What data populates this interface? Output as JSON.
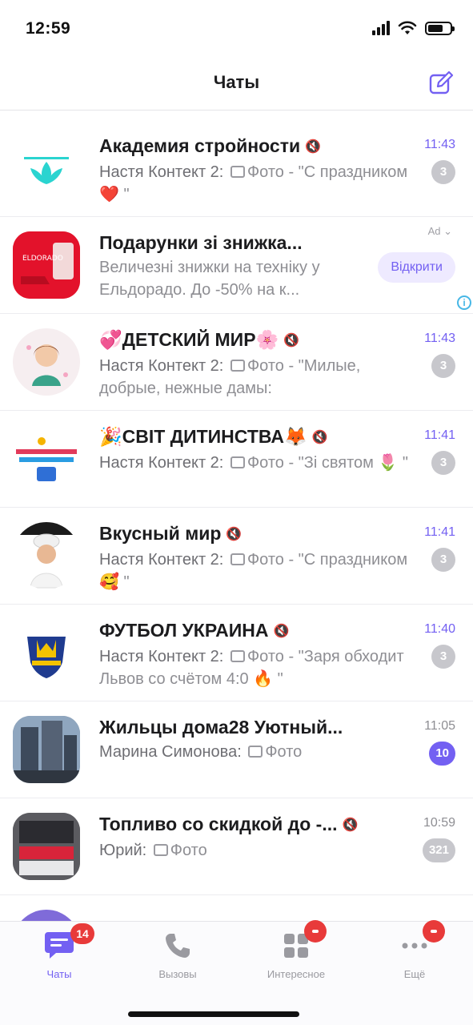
{
  "status_bar": {
    "time": "12:59"
  },
  "header": {
    "title": "Чаты"
  },
  "ad": {
    "label": "Ad",
    "title": "Подарунки зі знижка...",
    "text": "Величезні знижки на техніку у Ельдорадо. До -50% на к...",
    "button": "Відкрити"
  },
  "chats": [
    {
      "name": "Академия стройности",
      "sender": "Настя Контект 2:",
      "text": "Фото - \"С праздником ❤️ \"",
      "time": "11:43",
      "badge": "3"
    },
    {
      "name": "💞ДЕТСКИЙ МИР🌸",
      "sender": "Настя Контект 2:",
      "text": "Фото - \"Милые, добрые, нежные дамы:",
      "time": "11:43",
      "badge": "3"
    },
    {
      "name": "🎉СВІТ ДИТИНСТВА🦊",
      "sender": "Настя Контект 2:",
      "text": "Фото - \"Зі святом 🌷 \"",
      "time": "11:41",
      "badge": "3"
    },
    {
      "name": "Вкусный мир",
      "sender": "Настя Контект 2:",
      "text": "Фото - \"С праздником 🥰 \"",
      "time": "11:41",
      "badge": "3"
    },
    {
      "name": "ФУТБОЛ УКРАИНА",
      "sender": "Настя Контект 2:",
      "text": "Фото - \"Заря обходит Львов со счётом 4:0 🔥 \"",
      "time": "11:40",
      "badge": "3"
    },
    {
      "name": "Жильцы дома28 Уютный...",
      "sender": "Марина Симонова:",
      "text": "Фото",
      "time": "11:05",
      "badge": "10"
    },
    {
      "name": "Топливо со скидкой до -...",
      "sender": "Юрий:",
      "text": "Фото",
      "time": "10:59",
      "badge": "321"
    }
  ],
  "nav": {
    "chats": "Чаты",
    "chats_badge": "14",
    "calls": "Вызовы",
    "explore": "Интересное",
    "more": "Ещё"
  },
  "colors": {
    "accent": "#7360f2",
    "badge_red": "#e83a3a"
  }
}
